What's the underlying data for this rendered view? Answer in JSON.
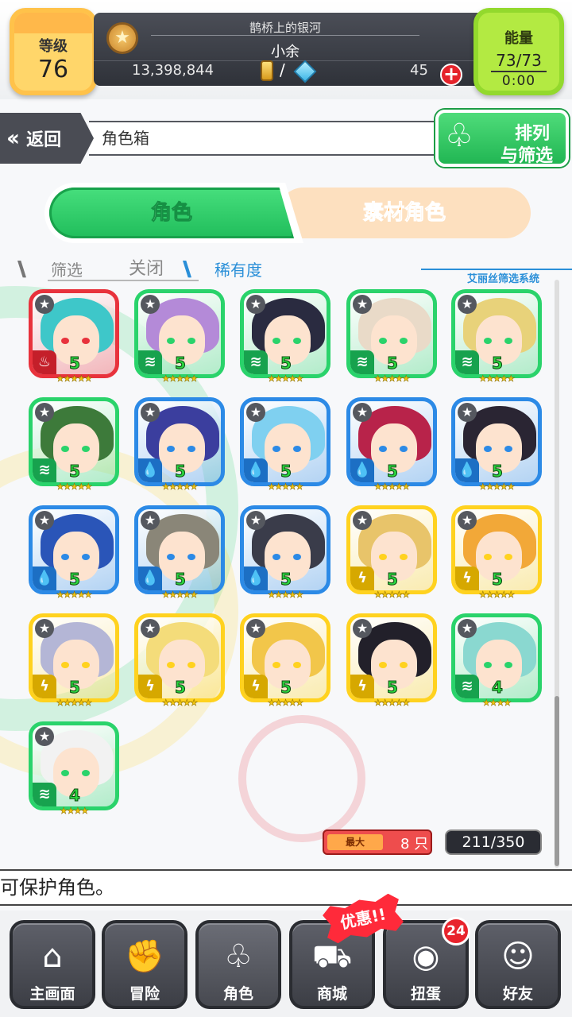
{
  "header": {
    "level_label": "等级",
    "level_value": "76",
    "player_title": "鹊桥上的银河",
    "player_name": "小余",
    "gold_amount": "13,398,844",
    "slash": "/",
    "crystal_amount": "45",
    "add_symbol": "+",
    "energy_label": "能量",
    "energy_value": "73/73",
    "energy_timer": "0:00"
  },
  "nav": {
    "back_label": "返回",
    "breadcrumb": "角色箱",
    "sort_line1": "排列",
    "sort_line2": "与筛选"
  },
  "tabs": {
    "characters": "角色",
    "materials": "素材角色"
  },
  "filter": {
    "label": "筛选",
    "state": "关闭",
    "rarity": "稀有度",
    "system": "艾丽丝筛选系统"
  },
  "colors": {
    "red": "#e8323c",
    "green": "#2ad36b",
    "blue": "#2c8ae6",
    "yellow": "#ffd21f"
  },
  "cards": [
    {
      "element": "red",
      "attr_icon": "fire",
      "level": "5",
      "stars": "★★★★★",
      "hair": "#3ec7c9"
    },
    {
      "element": "green",
      "attr_icon": "wind",
      "level": "5",
      "stars": "★★★★★",
      "hair": "#b48ad8"
    },
    {
      "element": "green",
      "attr_icon": "wind",
      "level": "5",
      "stars": "★★★★★",
      "hair": "#2a2b40"
    },
    {
      "element": "green",
      "attr_icon": "wind",
      "level": "5",
      "stars": "★★★★★",
      "hair": "#e9dac8"
    },
    {
      "element": "green",
      "attr_icon": "wind",
      "level": "5",
      "stars": "★★★★★",
      "hair": "#e8d27a"
    },
    {
      "element": "green",
      "attr_icon": "wind",
      "level": "5",
      "stars": "★★★★★",
      "hair": "#3d7a3a"
    },
    {
      "element": "blue",
      "attr_icon": "water",
      "level": "5",
      "stars": "★★★★★",
      "hair": "#3b3e9e"
    },
    {
      "element": "blue",
      "attr_icon": "water",
      "level": "5",
      "stars": "★★★★★",
      "hair": "#7fd0f0"
    },
    {
      "element": "blue",
      "attr_icon": "water",
      "level": "5",
      "stars": "★★★★★",
      "hair": "#b8234a"
    },
    {
      "element": "blue",
      "attr_icon": "water",
      "level": "5",
      "stars": "★★★★★",
      "hair": "#2a2533"
    },
    {
      "element": "blue",
      "attr_icon": "water",
      "level": "5",
      "stars": "★★★★★",
      "hair": "#2a55b8"
    },
    {
      "element": "blue",
      "attr_icon": "water",
      "level": "5",
      "stars": "★★★★★",
      "hair": "#8a8678"
    },
    {
      "element": "blue",
      "attr_icon": "water",
      "level": "5",
      "stars": "★★★★★",
      "hair": "#3a3c4a"
    },
    {
      "element": "yellow",
      "attr_icon": "thunder",
      "level": "5",
      "stars": "★★★★★",
      "hair": "#e8c46a"
    },
    {
      "element": "yellow",
      "attr_icon": "thunder",
      "level": "5",
      "stars": "★★★★★",
      "hair": "#f2a838"
    },
    {
      "element": "yellow",
      "attr_icon": "thunder",
      "level": "5",
      "stars": "★★★★★",
      "hair": "#b4b6d6"
    },
    {
      "element": "yellow",
      "attr_icon": "thunder",
      "level": "5",
      "stars": "★★★★★",
      "hair": "#f4dc7a"
    },
    {
      "element": "yellow",
      "attr_icon": "thunder",
      "level": "5",
      "stars": "★★★★★",
      "hair": "#f2c64a"
    },
    {
      "element": "yellow",
      "attr_icon": "thunder",
      "level": "5",
      "stars": "★★★★★",
      "hair": "#22202a"
    },
    {
      "element": "green",
      "attr_icon": "wind",
      "level": "4",
      "stars": "★★★★",
      "hair": "#8ad8d0"
    },
    {
      "element": "green",
      "attr_icon": "wind",
      "level": "4",
      "stars": "★★★★",
      "hair": "#f2f2f2"
    }
  ],
  "counters": {
    "max_label": "最大",
    "max_value": "8 只",
    "box_count": "211/350"
  },
  "ticker": "可保护角色。",
  "bottom_nav": [
    {
      "label": "主画面",
      "icon": "home-icon"
    },
    {
      "label": "冒险",
      "icon": "handshake-icon"
    },
    {
      "label": "角色",
      "icon": "bunny-icon"
    },
    {
      "label": "商城",
      "icon": "cart-icon"
    },
    {
      "label": "扭蛋",
      "icon": "egg-icon"
    },
    {
      "label": "好友",
      "icon": "friends-icon"
    }
  ],
  "promo": "优惠!!",
  "gacha_badge": "24"
}
